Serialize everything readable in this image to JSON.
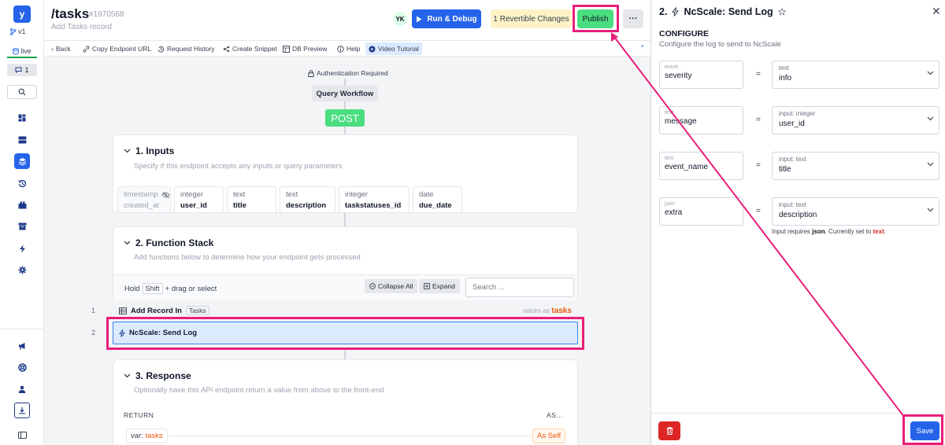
{
  "app": {
    "logo_letter": "y",
    "version": "v1",
    "env": "live",
    "comments_count": "1"
  },
  "rail_icons": [
    "search-icon",
    "dashboard-icon",
    "database-icon",
    "api-stack-icon",
    "history-icon",
    "library-icon",
    "archive-icon",
    "lightning-icon",
    "settings-icon",
    "megaphone-icon",
    "help-icon",
    "user-icon",
    "download-icon",
    "sidebar-toggle-icon"
  ],
  "header": {
    "title": "/tasks",
    "endpoint_id": "#1970568",
    "subtitle": "Add Tasks record",
    "avatar": "YK",
    "run_label": "Run & Debug",
    "revert_label": "1 Revertible Changes",
    "publish_label": "Publish",
    "more_label": "···"
  },
  "toolbar": {
    "back": "Back",
    "copy_url": "Copy Endpoint URL",
    "history": "Request History",
    "snippet": "Create Snippet",
    "db_preview": "DB Preview",
    "help": "Help",
    "video": "Video Tutorial"
  },
  "canvas": {
    "auth": "Authentication Required",
    "query_workflow": "Query Workflow",
    "method": "POST"
  },
  "inputs": {
    "title": "1. Inputs",
    "subtitle": "Specify if this endpoint accepts any inputs or query parameters",
    "items": [
      {
        "type": "timestamp",
        "name": "created_at",
        "disabled": true
      },
      {
        "type": "integer",
        "name": "user_id"
      },
      {
        "type": "text",
        "name": "title"
      },
      {
        "type": "text",
        "name": "description"
      },
      {
        "type": "integer",
        "name": "taskstatuses_id"
      },
      {
        "type": "date",
        "name": "due_date"
      }
    ]
  },
  "function_stack": {
    "title": "2. Function Stack",
    "subtitle": "Add functions below to determine how your endpoint gets processed",
    "hold": "Hold",
    "shift_key": "Shift",
    "drag_hint": "+ drag or select",
    "collapse_all": "Collapse All",
    "expand": "Expand",
    "search_placeholder": "Search ...",
    "rows": [
      {
        "num": "1",
        "label": "Add Record In",
        "tag": "Tasks",
        "return_prefix": "return as",
        "return_var": "tasks"
      },
      {
        "num": "2",
        "label": "NcScale: Send Log"
      }
    ]
  },
  "response": {
    "title": "3. Response",
    "subtitle": "Optionally have this API endpoint return a value from above to the front-end",
    "return_header": "RETURN",
    "as_header": "AS...",
    "var_prefix": "var:",
    "var_name": "tasks",
    "as_value": "As Self"
  },
  "panel": {
    "title": "2.",
    "title_name": "NcScale: Send Log",
    "configure": "CONFIGURE",
    "configure_sub": "Configure the log to send to NcScale",
    "fields": [
      {
        "type": "enum",
        "name": "severity",
        "value_type": "text",
        "value": "info"
      },
      {
        "type": "text",
        "name": "message",
        "value_type": "input: integer",
        "value": "user_id"
      },
      {
        "type": "text",
        "name": "event_name",
        "value_type": "input: text",
        "value": "title"
      },
      {
        "type": "json",
        "name": "extra",
        "value_type": "input: text",
        "value": "description"
      }
    ],
    "note_prefix": "Input requires",
    "note_type": "json",
    "note_mid": ". Currently set to",
    "note_current": "text",
    "note_end": ".",
    "save_label": "Save"
  },
  "colors": {
    "primary": "#2563eb",
    "highlight": "#e91e7a",
    "publish": "#4ade80",
    "danger": "#dc2626",
    "accent_orange": "#ea580c"
  }
}
